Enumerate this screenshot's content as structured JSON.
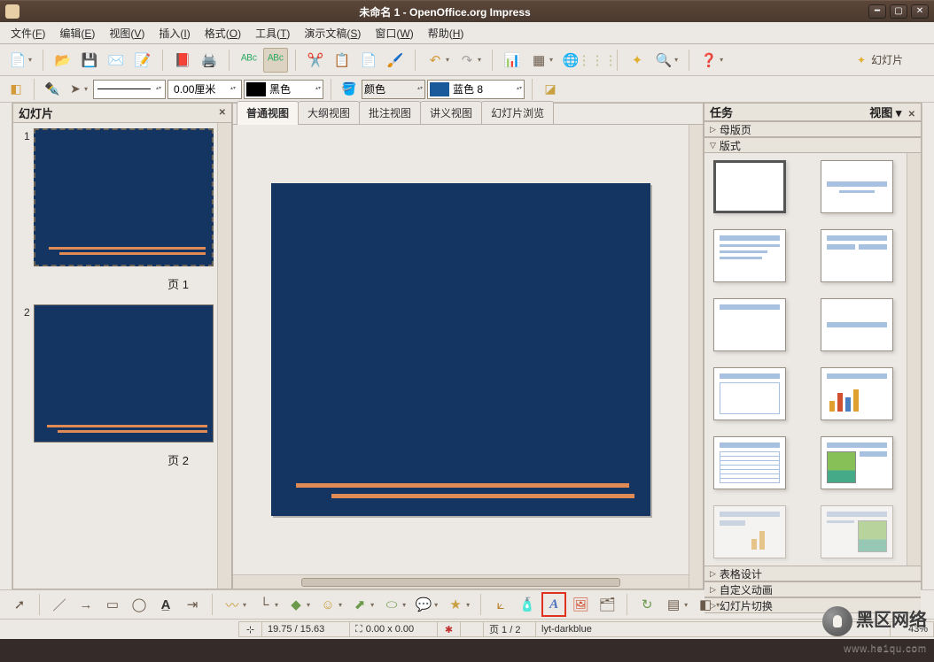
{
  "window": {
    "title": "未命名 1 - OpenOffice.org Impress"
  },
  "menu": {
    "file": "文件(",
    "file_u": "F",
    "file2": ")",
    "edit": "编辑(",
    "edit_u": "E",
    "edit2": ")",
    "view": "视图(",
    "view_u": "V",
    "view2": ")",
    "insert": "插入(",
    "insert_u": "I",
    "insert2": ")",
    "format": "格式(",
    "format_u": "O",
    "format2": ")",
    "tools": "工具(",
    "tools_u": "T",
    "tools2": ")",
    "slideshow": "演示文稿(",
    "slideshow_u": "S",
    "slideshow2": ")",
    "window": "窗口(",
    "window_u": "W",
    "window2": ")",
    "help": "帮助(",
    "help_u": "H",
    "help2": ")"
  },
  "toolbar1": {
    "slideshow_label": "幻灯片"
  },
  "toolbar2": {
    "line_width": "0.00厘米",
    "color1": "黑色",
    "fill_label": "颜色",
    "color2": "蓝色 8"
  },
  "slides_panel": {
    "title": "幻灯片",
    "slides": [
      {
        "num": "1",
        "label": "页 1"
      },
      {
        "num": "2",
        "label": "页 2"
      }
    ]
  },
  "view_tabs": [
    "普通视图",
    "大纲视图",
    "批注视图",
    "讲义视图",
    "幻灯片浏览"
  ],
  "tasks": {
    "title": "任务",
    "view_label": "视图",
    "sections": [
      "母版页",
      "版式",
      "表格设计",
      "自定义动画",
      "幻灯片切换"
    ]
  },
  "status": {
    "coords": "19.75 / 15.63",
    "size": "0.00 x 0.00",
    "page": "页 1 / 2",
    "master": "lyt-darkblue",
    "zoom": "43%"
  },
  "watermark": {
    "main": "黑区网络",
    "sub": "www.he1qu.com"
  }
}
